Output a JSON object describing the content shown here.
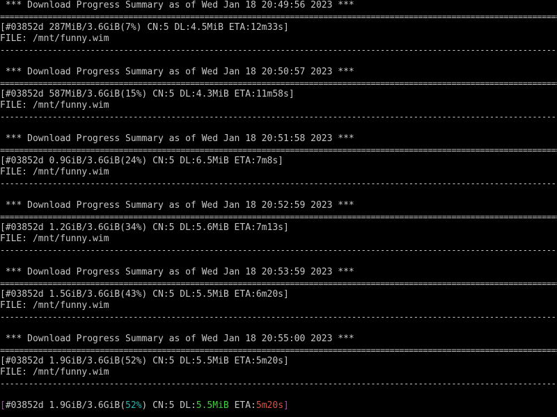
{
  "terminal": {
    "rule_double": "==================================================================================================================================",
    "rule_single": "----------------------------------------------------------------------------------------------------------------------------------",
    "summaries": [
      {
        "header": " *** Download Progress Summary as of Wed Jan 18 20:49:56 2023 ***",
        "status": "[#03852d 287MiB/3.6GiB(7%) CN:5 DL:4.5MiB ETA:12m33s]",
        "file": "FILE: /mnt/funny.wim"
      },
      {
        "header": " *** Download Progress Summary as of Wed Jan 18 20:50:57 2023 ***",
        "status": "[#03852d 587MiB/3.6GiB(15%) CN:5 DL:4.3MiB ETA:11m58s]",
        "file": "FILE: /mnt/funny.wim"
      },
      {
        "header": " *** Download Progress Summary as of Wed Jan 18 20:51:58 2023 ***",
        "status": "[#03852d 0.9GiB/3.6GiB(24%) CN:5 DL:6.5MiB ETA:7m8s]",
        "file": "FILE: /mnt/funny.wim"
      },
      {
        "header": " *** Download Progress Summary as of Wed Jan 18 20:52:59 2023 ***",
        "status": "[#03852d 1.2GiB/3.6GiB(34%) CN:5 DL:5.6MiB ETA:7m13s]",
        "file": "FILE: /mnt/funny.wim"
      },
      {
        "header": " *** Download Progress Summary as of Wed Jan 18 20:53:59 2023 ***",
        "status": "[#03852d 1.5GiB/3.6GiB(43%) CN:5 DL:5.5MiB ETA:6m20s]",
        "file": "FILE: /mnt/funny.wim"
      },
      {
        "header": " *** Download Progress Summary as of Wed Jan 18 20:55:00 2023 ***",
        "status": "[#03852d 1.9GiB/3.6GiB(52%) CN:5 DL:5.5MiB ETA:5m20s]",
        "file": "FILE: /mnt/funny.wim"
      }
    ],
    "live": {
      "open_bracket": "[",
      "gid_size": "#03852d 1.9GiB/3.6GiB(",
      "percent": "52%",
      "after_percent": ") CN:5 DL:",
      "speed": "5.5MiB",
      "eta_label": " ETA:",
      "eta": "5m20s",
      "close_bracket": "]",
      "progress_fraction": 0.52
    },
    "colors": {
      "background": "#000000",
      "text": "#c8c8c8",
      "bracket": "#c040c0",
      "percent": "#20b8b0",
      "speed": "#40d040",
      "eta": "#e05040"
    }
  }
}
